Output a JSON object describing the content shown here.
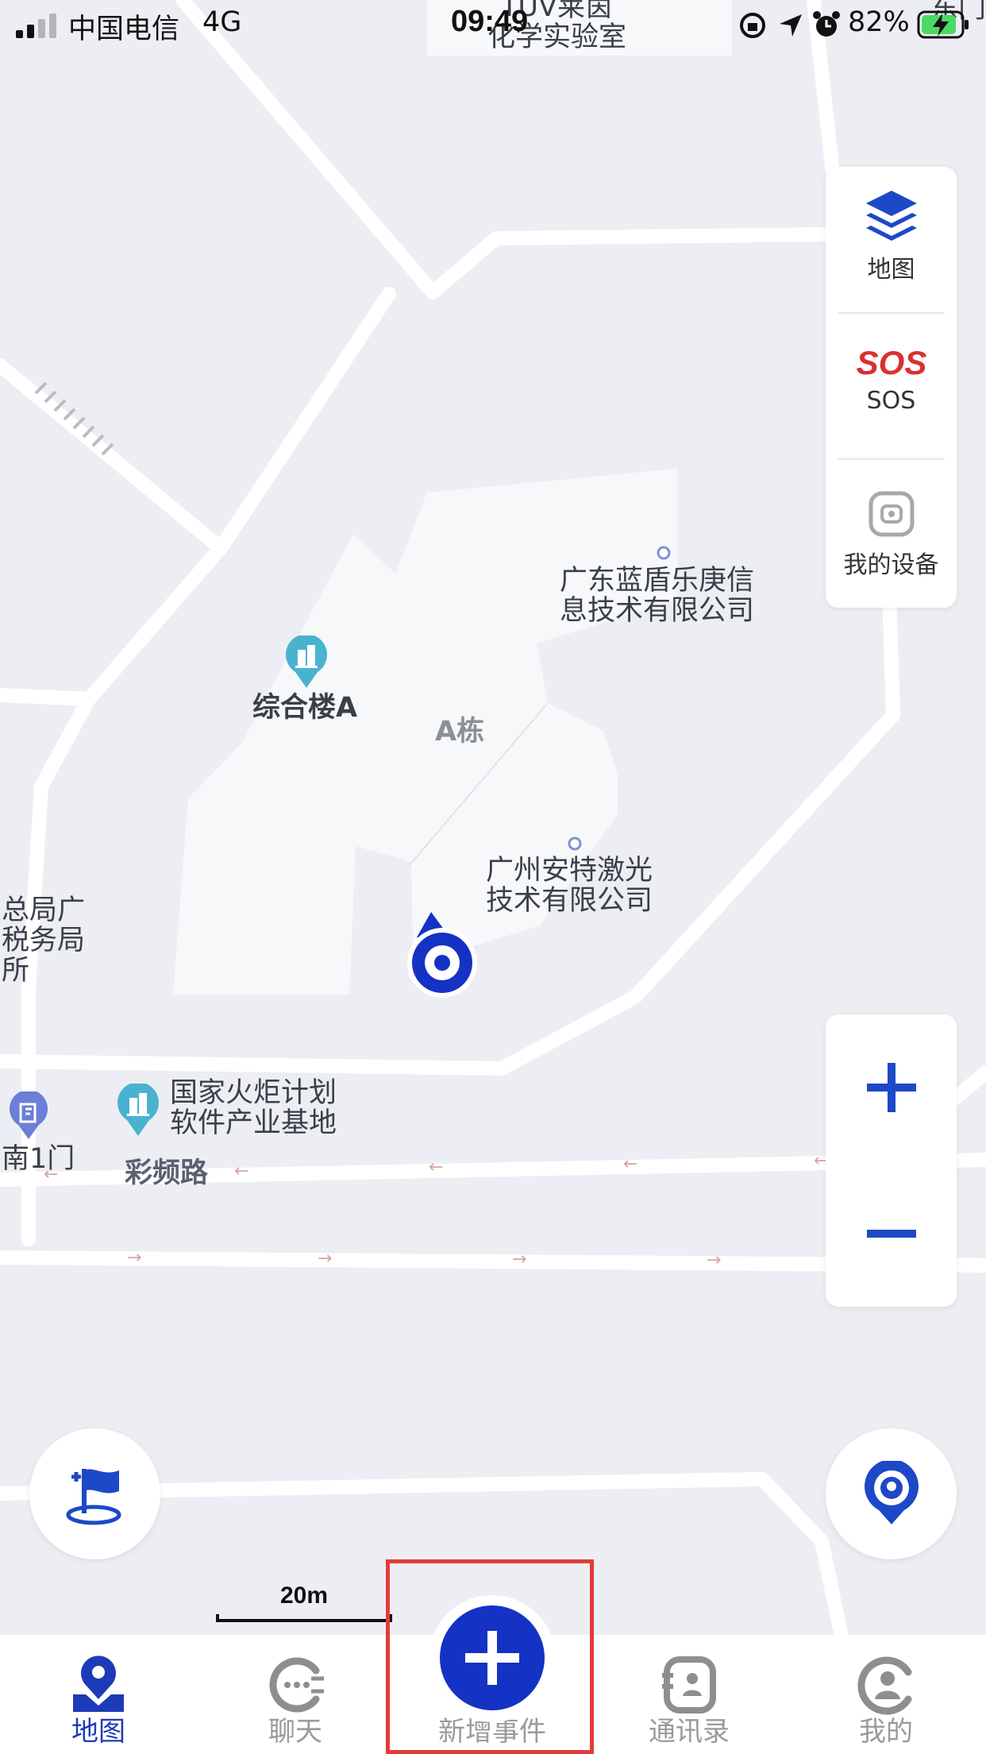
{
  "status_bar": {
    "carrier": "中国电信",
    "network": "4G",
    "time": "09:49",
    "battery": "82%"
  },
  "map": {
    "labels": {
      "top_building": "TUV莱茵\n化学实验室",
      "top_right_edge": "东门",
      "company_1": "广东蓝盾乐庚信\n息技术有限公司",
      "building_a_poi": "综合楼A",
      "block_a": "A栋",
      "company_2": "广州安特激光\n技术有限公司",
      "left_edge": "总局广\n税务局\n所",
      "torch_base": "国家火炬计划\n软件产业基地",
      "south_gate": "南1门",
      "road": "彩频路"
    }
  },
  "layer_panel": {
    "map_label": "地图",
    "sos_label": "SOS",
    "device_label": "我的设备"
  },
  "zoom": {
    "in_icon": "plus-icon",
    "out_icon": "minus-icon"
  },
  "scale": {
    "text": "20m"
  },
  "tabs": [
    {
      "label": "地图",
      "icon": "map-pin-icon",
      "active": true
    },
    {
      "label": "聊天",
      "icon": "chat-icon",
      "active": false
    },
    {
      "label": "新增事件",
      "icon": "add-icon",
      "active": false
    },
    {
      "label": "通讯录",
      "icon": "contacts-icon",
      "active": false
    },
    {
      "label": "我的",
      "icon": "profile-icon",
      "active": false
    }
  ],
  "colors": {
    "accent": "#1432c4",
    "sos": "#d9312f",
    "highlight": "#e33b3b",
    "poi": "#49b3cf"
  }
}
